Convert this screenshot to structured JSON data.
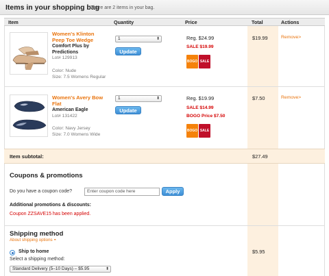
{
  "header": {
    "title": "Items in your shopping bag",
    "subtitle": "There are 2 items in your bag."
  },
  "columns": {
    "item": "Item",
    "quantity": "Quantity",
    "price": "Price",
    "total": "Total",
    "actions": "Actions"
  },
  "items": [
    {
      "name_line1": "Women's Klinton",
      "name_line2": "Peep Toe Wedge",
      "brand_line1": "Comfort Plus by",
      "brand_line2": "Predictions",
      "lot": "Lot# 129913",
      "color": "Color: Nude",
      "size": "Size: 7.5 Womens Regular",
      "qty": "1",
      "update_label": "Update",
      "reg_price": "Reg. $24.99",
      "sale_price": "SALE $19.99",
      "bogo_price": "",
      "badge_bogo": "BOGO",
      "badge_sale": "SALE",
      "total": "$19.99",
      "remove_label": "Remove>"
    },
    {
      "name_line1": "Women's Avery Bow",
      "name_line2": "Flat",
      "brand_line1": "American Eagle",
      "brand_line2": "",
      "lot": "Lot# 131422",
      "color": "Color: Navy Jersey",
      "size": "Size: 7.0 Womens Wide",
      "qty": "1",
      "update_label": "Update",
      "reg_price": "Reg. $19.99",
      "sale_price": "SALE $14.99",
      "bogo_price": "BOGO Price $7.50",
      "badge_bogo": "BOGO",
      "badge_sale": "SALE",
      "total": "$7.50",
      "remove_label": "Remove>"
    }
  ],
  "subtotal": {
    "label": "Item subtotal:",
    "value": "$27.49"
  },
  "coupons": {
    "title": "Coupons & promotions",
    "question": "Do you have a coupon code?",
    "placeholder": "Enter coupon code here",
    "apply_label": "Apply",
    "additional_title": "Additional promotions & discounts:",
    "applied_msg": "Coupon ZZSAVE15 has been applied."
  },
  "shipping": {
    "title": "Shipping method",
    "about_link": "About shipping options",
    "option_label": "Ship to home",
    "select_prompt": "Select a shipping method:",
    "selected": "Standard Delivery (5–10 Days) – $5.95",
    "cost": "$5.95"
  },
  "colors": {
    "accent_orange": "#e9730c",
    "sale_red": "#d40000",
    "button_blue": "#3e8fd6",
    "total_band": "#fdf0df"
  }
}
